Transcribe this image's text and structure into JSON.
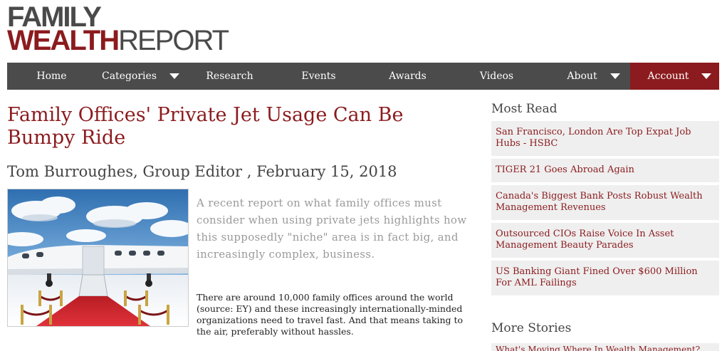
{
  "logo": {
    "line1": "FAMILY",
    "line2a": "WEALTH",
    "line2b": "REPORT"
  },
  "nav": {
    "items": [
      {
        "label": "Home"
      },
      {
        "label": "Categories"
      },
      {
        "label": "Research"
      },
      {
        "label": "Events"
      },
      {
        "label": "Awards"
      },
      {
        "label": "Videos"
      },
      {
        "label": "About"
      },
      {
        "label": "Account"
      }
    ]
  },
  "article": {
    "title": "Family Offices' Private Jet Usage Can Be Bumpy Ride",
    "byline": "Tom Burroughes, Group Editor , February 15, 2018",
    "lead": "A recent report on what family offices must consider when using private jets highlights how this supposedly \"niche\" area is in fact big, and increasingly complex, business.",
    "body": "There are around 10,000 family offices around the world (source: EY) and these increasingly internationally-minded organizations need to travel fast. And that means taking to the air, preferably without hassles."
  },
  "sidebar": {
    "most_read_heading": "Most Read",
    "most_read": [
      {
        "title": "San Francisco, London Are Top Expat Job Hubs - HSBC"
      },
      {
        "title": "TIGER 21 Goes Abroad Again"
      },
      {
        "title": "Canada's Biggest Bank Posts Robust Wealth Management Revenues"
      },
      {
        "title": "Outsourced CIOs Raise Voice In Asset Management Beauty Parades"
      },
      {
        "title": "US Banking Giant Fined Over $600 Million For AML Failings"
      }
    ],
    "more_stories_heading": "More Stories",
    "more_stories_partial": "What's Moving Where In Wealth Management?"
  },
  "colors": {
    "brand": "#8b1b1e",
    "nav_bg": "#4b4b4b",
    "sidebar_item_bg": "#efefef"
  }
}
